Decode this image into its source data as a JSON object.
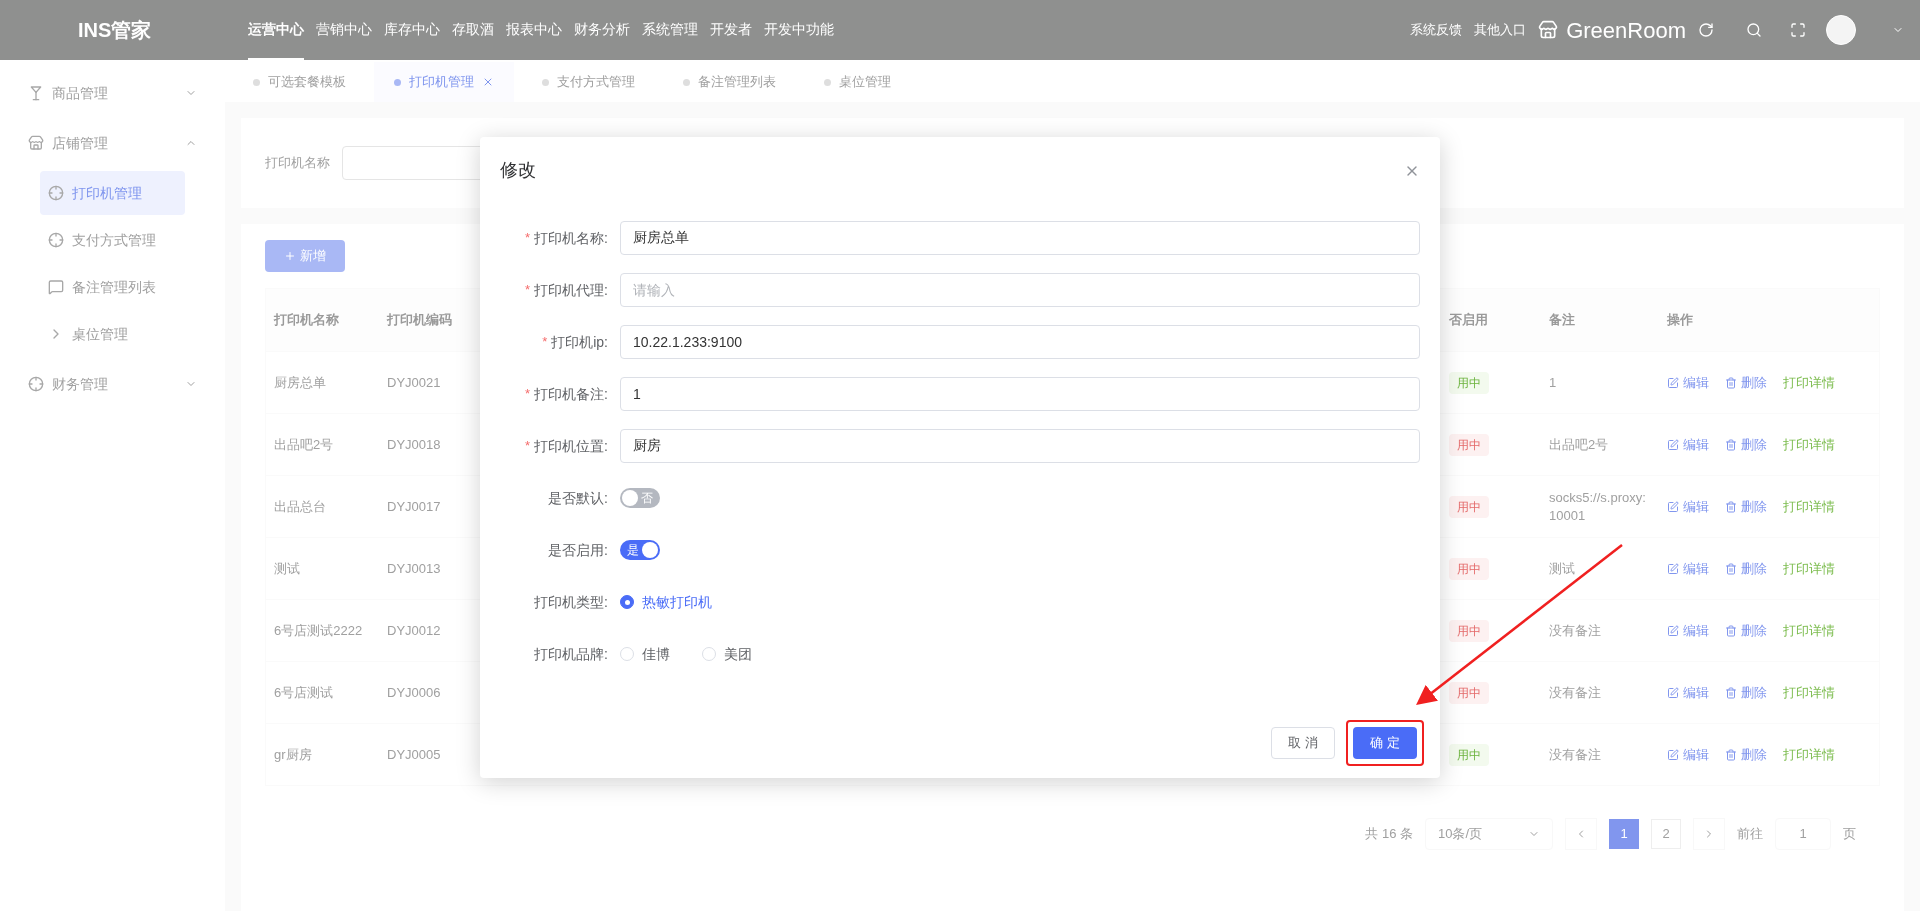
{
  "header": {
    "logo": "INS管家",
    "nav": [
      {
        "label": "运营中心",
        "selected": true
      },
      {
        "label": "营销中心",
        "selected": false
      },
      {
        "label": "库存中心",
        "selected": false
      },
      {
        "label": "存取酒",
        "selected": false
      },
      {
        "label": "报表中心",
        "selected": false
      },
      {
        "label": "财务分析",
        "selected": false
      },
      {
        "label": "系统管理",
        "selected": false
      },
      {
        "label": "开发者",
        "selected": false
      },
      {
        "label": "开发中功能",
        "selected": false
      }
    ],
    "links": [
      "系统反馈",
      "其他入口"
    ],
    "store": "GreenRoom"
  },
  "tabs": [
    {
      "label": "可选套餐模板",
      "selected": false
    },
    {
      "label": "打印机管理",
      "selected": true,
      "closable": true
    },
    {
      "label": "支付方式管理",
      "selected": false
    },
    {
      "label": "备注管理列表",
      "selected": false
    },
    {
      "label": "桌位管理",
      "selected": false
    }
  ],
  "sidebar": {
    "items": [
      {
        "label": "商品管理",
        "expanded": false
      },
      {
        "label": "店铺管理",
        "expanded": true,
        "children": [
          {
            "label": "打印机管理",
            "selected": true
          },
          {
            "label": "支付方式管理",
            "selected": false
          },
          {
            "label": "备注管理列表",
            "selected": false
          },
          {
            "label": "桌位管理",
            "selected": false
          }
        ]
      },
      {
        "label": "财务管理",
        "expanded": false
      }
    ]
  },
  "search": {
    "label": "打印机名称"
  },
  "add_button": "新增",
  "table": {
    "columns": [
      "打印机名称",
      "打印机编码",
      "否启用",
      "备注",
      "操作"
    ],
    "rows": [
      {
        "name": "厨房总单",
        "code": "DYJ0021",
        "status": "用中",
        "enabled": true,
        "note": "1",
        "actions": [
          {
            "kind": "edit",
            "label": "编辑"
          },
          {
            "kind": "delete",
            "label": "删除"
          },
          {
            "kind": "detail",
            "label": "打印详情"
          }
        ]
      },
      {
        "name": "出品吧2号",
        "code": "DYJ0018",
        "status": "用中",
        "enabled": false,
        "note": "出品吧2号",
        "actions": [
          {
            "kind": "edit",
            "label": "编辑"
          },
          {
            "kind": "delete",
            "label": "删除"
          },
          {
            "kind": "detail",
            "label": "打印详情"
          }
        ]
      },
      {
        "name": "出品总台",
        "code": "DYJ0017",
        "status": "用中",
        "enabled": false,
        "note": "socks5://s.proxy:10001",
        "actions": [
          {
            "kind": "edit",
            "label": "编辑"
          },
          {
            "kind": "delete",
            "label": "删除"
          },
          {
            "kind": "detail",
            "label": "打印详情"
          }
        ]
      },
      {
        "name": "测试",
        "code": "DYJ0013",
        "status": "用中",
        "enabled": false,
        "note": "测试",
        "actions": [
          {
            "kind": "edit",
            "label": "编辑"
          },
          {
            "kind": "delete",
            "label": "删除"
          },
          {
            "kind": "detail",
            "label": "打印详情"
          }
        ]
      },
      {
        "name": "6号店测试2222",
        "code": "DYJ0012",
        "status": "用中",
        "enabled": false,
        "note": "没有备注",
        "actions": [
          {
            "kind": "edit",
            "label": "编辑"
          },
          {
            "kind": "delete",
            "label": "删除"
          },
          {
            "kind": "detail",
            "label": "打印详情"
          }
        ]
      },
      {
        "name": "6号店测试",
        "code": "DYJ0006",
        "status": "用中",
        "enabled": false,
        "note": "没有备注",
        "actions": [
          {
            "kind": "edit",
            "label": "编辑"
          },
          {
            "kind": "delete",
            "label": "删除"
          },
          {
            "kind": "detail",
            "label": "打印详情"
          }
        ]
      },
      {
        "name": "gr厨房",
        "code": "DYJ0005",
        "status": "用中",
        "enabled": true,
        "note": "没有备注",
        "actions": [
          {
            "kind": "edit",
            "label": "编辑"
          },
          {
            "kind": "delete",
            "label": "删除"
          },
          {
            "kind": "detail",
            "label": "打印详情"
          }
        ]
      }
    ]
  },
  "pagination": {
    "total": "共 16 条",
    "page_size": "10条/页",
    "pages": [
      {
        "label": "1",
        "selected": true
      },
      {
        "label": "2",
        "selected": false
      }
    ],
    "goto_label": "前往",
    "goto_value": "1",
    "goto_suffix": "页"
  },
  "dialog": {
    "title": "修改",
    "fields": [
      {
        "kind": "text",
        "label": "打印机名称:",
        "required_mark": "*",
        "value": "厨房总单"
      },
      {
        "kind": "text",
        "label": "打印机代理:",
        "required_mark": "*",
        "placeholder": "请输入"
      },
      {
        "kind": "text",
        "label": "打印机ip:",
        "required_mark": "*",
        "value": "10.22.1.233:9100"
      },
      {
        "kind": "text",
        "label": "打印机备注:",
        "required_mark": "*",
        "value": "1"
      },
      {
        "kind": "text",
        "label": "打印机位置:",
        "required_mark": "*",
        "value": "厨房"
      },
      {
        "kind": "switch",
        "label": "是否默认:",
        "on": false,
        "text": "否"
      },
      {
        "kind": "switch",
        "label": "是否启用:",
        "on": true,
        "text": "是"
      },
      {
        "kind": "radio",
        "label": "打印机类型:",
        "options": [
          {
            "label": "热敏打印机",
            "selected": true
          }
        ]
      },
      {
        "kind": "radio",
        "label": "打印机品牌:",
        "options": [
          {
            "label": "佳博",
            "selected": false
          },
          {
            "label": "美团",
            "selected": false
          }
        ]
      }
    ],
    "buttons": [
      {
        "kind": "cancel",
        "label": "取 消",
        "highlighted": false
      },
      {
        "kind": "confirm",
        "label": "确 定",
        "highlighted": true
      }
    ]
  }
}
